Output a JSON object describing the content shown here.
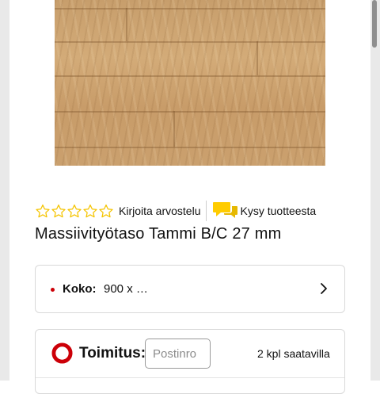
{
  "product": {
    "image_alt": "Massiivityötaso Tammi B/C 27 mm",
    "title": "Massiivityötaso Tammi B/C 27 mm",
    "rating": {
      "value": 0,
      "max": 5
    }
  },
  "actions": {
    "write_review": "Kirjoita arvostelu",
    "ask_question": "Kysy tuotteesta"
  },
  "size_selector": {
    "label": "Koko:",
    "value": "900 x …"
  },
  "delivery": {
    "label": "Toimitus:",
    "postal_placeholder": "Postinro",
    "stock_text": "2 kpl saatavilla"
  },
  "colors": {
    "accent_red": "#cc0008",
    "star_yellow": "#f5c400",
    "chat_yellow": "#ffcc00"
  },
  "icons": [
    "star-outline-icon",
    "chat-bubbles-icon",
    "chevron-right-icon",
    "delivery-status-icon"
  ]
}
